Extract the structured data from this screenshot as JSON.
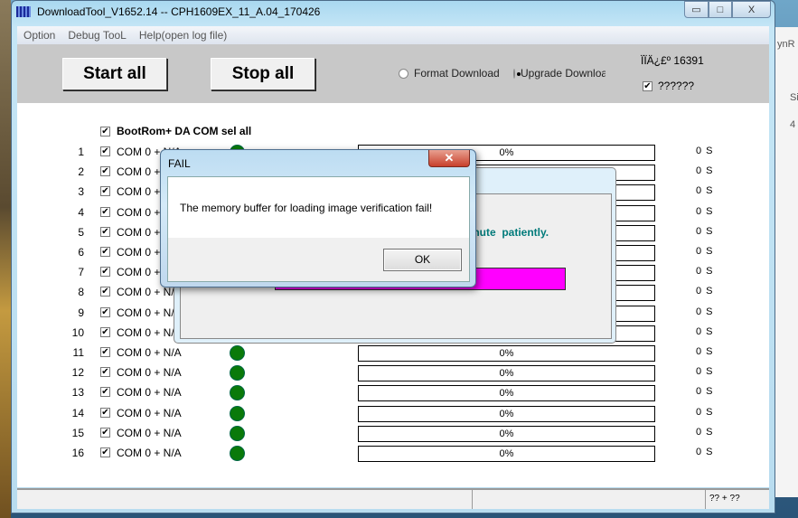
{
  "window": {
    "title": "DownloadTool_V1652.14 -- CPH1609EX_11_A.04_170426",
    "minimize": "▭",
    "maximize": "□",
    "close": "X"
  },
  "menu": [
    "Option",
    "Debug TooL",
    "Help(open log file)"
  ],
  "toolbar": {
    "start_all": "Start all",
    "stop_all": "Stop all",
    "format_download": "Format Download",
    "upgrade_download": "Upgrade Downloa",
    "selected_mode": "upgrade",
    "info_text": "ÏÏÄ¿£º 16391",
    "extra_checkbox_label": "??????",
    "extra_checked": true
  },
  "select_all": {
    "label": "BootRom+ DA COM sel all",
    "checked": true
  },
  "ports": [
    {
      "num": "1",
      "com": "COM 0 + N/A",
      "progress": "0%",
      "time": "0 S"
    },
    {
      "num": "2",
      "com": "COM 0 + N/A",
      "progress": "0%",
      "time": "0 S"
    },
    {
      "num": "3",
      "com": "COM 0 + N/A",
      "progress": "0%",
      "time": "0 S"
    },
    {
      "num": "4",
      "com": "COM 0 + N/A",
      "progress": "0%",
      "time": "0 S"
    },
    {
      "num": "5",
      "com": "COM 0 + N/A",
      "progress": "0%",
      "time": "0 S"
    },
    {
      "num": "6",
      "com": "COM 0 + N/A",
      "progress": "0%",
      "time": "0 S"
    },
    {
      "num": "7",
      "com": "COM 0 + N/A",
      "progress": "0%",
      "time": "0 S"
    },
    {
      "num": "8",
      "com": "COM 0 + N/A",
      "progress": "0%",
      "time": "0 S"
    },
    {
      "num": "9",
      "com": "COM 0 + N/A",
      "progress": "0%",
      "time": "0 S"
    },
    {
      "num": "10",
      "com": "COM 0 + N/A",
      "progress": "0%",
      "time": "0 S"
    },
    {
      "num": "11",
      "com": "COM 0 + N/A",
      "progress": "0%",
      "time": "0 S"
    },
    {
      "num": "12",
      "com": "COM 0 + N/A",
      "progress": "0%",
      "time": "0 S"
    },
    {
      "num": "13",
      "com": "COM 0 + N/A",
      "progress": "0%",
      "time": "0 S"
    },
    {
      "num": "14",
      "com": "COM 0 + N/A",
      "progress": "0%",
      "time": "0 S"
    },
    {
      "num": "15",
      "com": "COM 0 + N/A",
      "progress": "0%",
      "time": "0 S"
    },
    {
      "num": "16",
      "com": "COM 0 + N/A",
      "progress": "0%",
      "time": "0 S"
    }
  ],
  "status_bar": {
    "right": "?? + ??"
  },
  "background_dialog": {
    "message": "inute  patiently.",
    "progress_color": "#ff00ff"
  },
  "fail_dialog": {
    "title": "FAIL",
    "message": "The memory buffer for loading image verification fail!",
    "ok": "OK",
    "close": "✕"
  },
  "desktop_right": [
    "ynR",
    "Si",
    "4"
  ],
  "colors": {
    "led": "#0a7a0a",
    "toolbar": "#c8c8c8",
    "accent_text": "#007a7a"
  }
}
